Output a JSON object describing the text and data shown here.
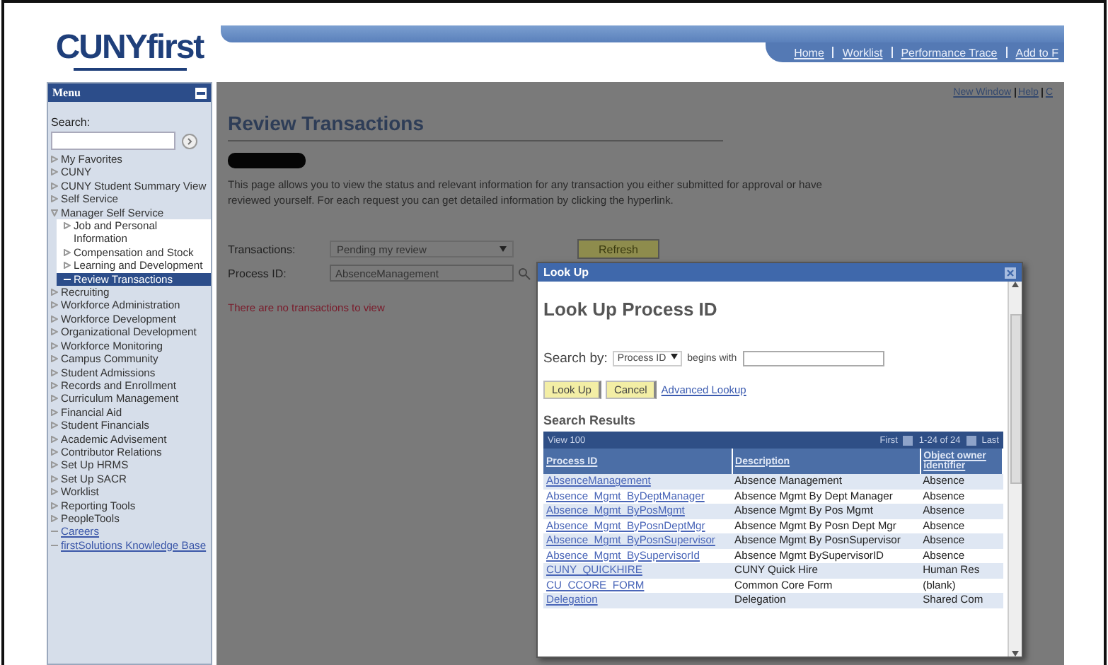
{
  "logo": {
    "text": "CUNYfirst"
  },
  "nav_links": [
    "Home",
    "Worklist",
    "Performance Trace",
    "Add to F"
  ],
  "menu": {
    "title": "Menu",
    "search_label": "Search:",
    "items": [
      {
        "label": "My Favorites",
        "kind": "folder",
        "expanded": false,
        "selected": false
      },
      {
        "label": "CUNY",
        "kind": "folder",
        "expanded": false,
        "selected": false
      },
      {
        "label": "CUNY Student Summary View",
        "kind": "folder",
        "expanded": false,
        "selected": false
      },
      {
        "label": "Self Service",
        "kind": "folder",
        "expanded": false,
        "selected": false
      },
      {
        "label": "Manager Self Service",
        "kind": "folder",
        "expanded": true,
        "selected": false,
        "children": [
          {
            "label": "Job and Personal Information",
            "kind": "folder",
            "expanded": false,
            "selected": false
          },
          {
            "label": "Compensation and Stock",
            "kind": "folder",
            "expanded": false,
            "selected": false
          },
          {
            "label": "Learning and Development",
            "kind": "folder",
            "expanded": false,
            "selected": false
          },
          {
            "label": "Review Transactions",
            "kind": "page",
            "selected": true
          }
        ]
      },
      {
        "label": "Recruiting",
        "kind": "folder",
        "expanded": false,
        "selected": false
      },
      {
        "label": "Workforce Administration",
        "kind": "folder",
        "expanded": false,
        "selected": false
      },
      {
        "label": "Workforce Development",
        "kind": "folder",
        "expanded": false,
        "selected": false
      },
      {
        "label": "Organizational Development",
        "kind": "folder",
        "expanded": false,
        "selected": false
      },
      {
        "label": "Workforce Monitoring",
        "kind": "folder",
        "expanded": false,
        "selected": false
      },
      {
        "label": "Campus Community",
        "kind": "folder",
        "expanded": false,
        "selected": false
      },
      {
        "label": "Student Admissions",
        "kind": "folder",
        "expanded": false,
        "selected": false
      },
      {
        "label": "Records and Enrollment",
        "kind": "folder",
        "expanded": false,
        "selected": false
      },
      {
        "label": "Curriculum Management",
        "kind": "folder",
        "expanded": false,
        "selected": false
      },
      {
        "label": "Financial Aid",
        "kind": "folder",
        "expanded": false,
        "selected": false
      },
      {
        "label": "Student Financials",
        "kind": "folder",
        "expanded": false,
        "selected": false
      },
      {
        "label": "Academic Advisement",
        "kind": "folder",
        "expanded": false,
        "selected": false
      },
      {
        "label": "Contributor Relations",
        "kind": "folder",
        "expanded": false,
        "selected": false
      },
      {
        "label": "Set Up HRMS",
        "kind": "folder",
        "expanded": false,
        "selected": false
      },
      {
        "label": "Set Up SACR",
        "kind": "folder",
        "expanded": false,
        "selected": false
      },
      {
        "label": "Worklist",
        "kind": "folder",
        "expanded": false,
        "selected": false
      },
      {
        "label": "Reporting Tools",
        "kind": "folder",
        "expanded": false,
        "selected": false
      },
      {
        "label": "PeopleTools",
        "kind": "folder",
        "expanded": false,
        "selected": false
      },
      {
        "label": "Careers",
        "kind": "link",
        "selected": false
      },
      {
        "label": "firstSolutions Knowledge Base",
        "kind": "link",
        "selected": false
      }
    ]
  },
  "page_links": [
    "New Window",
    "Help",
    "C"
  ],
  "page": {
    "title": "Review Transactions",
    "description": "This page allows you to view the status and relevant information for any transaction you either submitted for approval or have reviewed yourself. For each request you can get detailed information by clicking the hyperlink.",
    "transactions_label": "Transactions:",
    "transactions_value": "Pending my review",
    "process_label": "Process ID:",
    "process_value": "AbsenceManagement",
    "refresh_button": "Refresh",
    "message": "There are no transactions to view"
  },
  "lookup": {
    "window_title": "Look Up",
    "heading": "Look Up Process ID",
    "search_by_label": "Search by:",
    "search_by_value": "Process ID",
    "operator": "begins with",
    "buttons": [
      "Look Up",
      "Cancel"
    ],
    "advanced_link": "Advanced Lookup",
    "results_title": "Search Results",
    "grid_nav": {
      "view": "View 100",
      "first": "First",
      "range": "1-24 of 24",
      "last": "Last"
    },
    "columns": [
      "Process ID",
      "Description",
      "Object owner identifier"
    ],
    "rows": [
      [
        "AbsenceManagement",
        "Absence Management",
        "Absence"
      ],
      [
        "Absence_Mgmt_ByDeptManager",
        "Absence Mgmt By Dept Manager",
        "Absence"
      ],
      [
        "Absence_Mgmt_ByPosMgmt",
        "Absence Mgmt By Pos Mgmt",
        "Absence"
      ],
      [
        "Absence_Mgmt_ByPosnDeptMgr",
        "Absence Mgmt  By Posn Dept Mgr",
        "Absence"
      ],
      [
        "Absence_Mgmt_ByPosnSupervisor",
        "Absence Mgmt By PosnSupervisor",
        "Absence"
      ],
      [
        "Absence_Mgmt_BySupervisorId",
        "Absence Mgmt BySupervisorID",
        "Absence"
      ],
      [
        "CUNY_QUICKHIRE",
        "CUNY Quick Hire",
        "Human Res"
      ],
      [
        "CU_CCORE_FORM",
        "Common Core Form",
        "(blank)"
      ],
      [
        "Delegation",
        "Delegation",
        "Shared Com"
      ]
    ]
  }
}
